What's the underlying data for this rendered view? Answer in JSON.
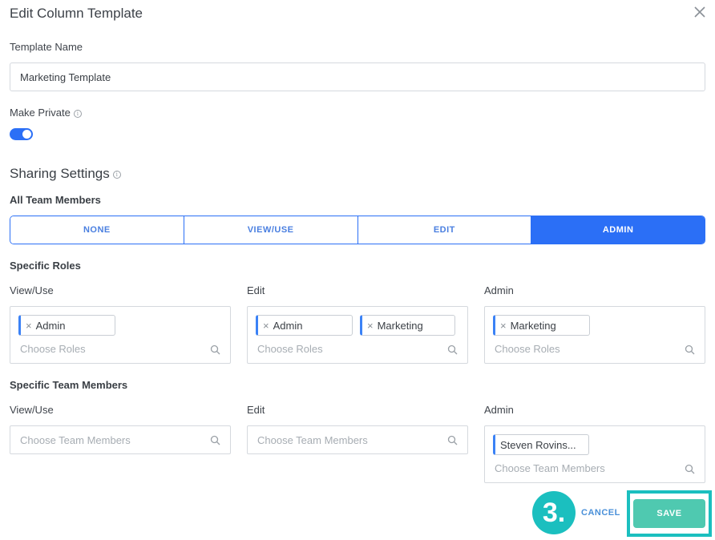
{
  "dialog": {
    "title": "Edit Column Template",
    "close_icon": "close-icon"
  },
  "template_name": {
    "label": "Template Name",
    "value": "Marketing Template"
  },
  "make_private": {
    "label": "Make Private",
    "enabled": true,
    "info_icon": "info-icon"
  },
  "sharing": {
    "title": "Sharing Settings",
    "info_icon": "info-icon",
    "all_team_members_label": "All Team Members",
    "options": [
      "NONE",
      "VIEW/USE",
      "EDIT",
      "ADMIN"
    ],
    "selected": "ADMIN",
    "accent_color": "#2b6ff6"
  },
  "specific_roles": {
    "label": "Specific Roles",
    "columns": [
      {
        "label": "View/Use",
        "tags": [
          "Admin"
        ],
        "placeholder": "Choose Roles"
      },
      {
        "label": "Edit",
        "tags": [
          "Admin",
          "Marketing"
        ],
        "placeholder": "Choose Roles"
      },
      {
        "label": "Admin",
        "tags": [
          "Marketing"
        ],
        "placeholder": "Choose Roles"
      }
    ]
  },
  "specific_team_members": {
    "label": "Specific Team Members",
    "columns": [
      {
        "label": "View/Use",
        "tags": [],
        "placeholder": "Choose Team Members"
      },
      {
        "label": "Edit",
        "tags": [],
        "placeholder": "Choose Team Members"
      },
      {
        "label": "Admin",
        "tags": [
          "Steven Rovins..."
        ],
        "placeholder": "Choose Team Members"
      }
    ]
  },
  "footer": {
    "cancel_label": "CANCEL",
    "save_label": "SAVE",
    "step_marker": "3.",
    "highlight_color": "#1bbfbf",
    "save_color": "#4fc9b0"
  }
}
